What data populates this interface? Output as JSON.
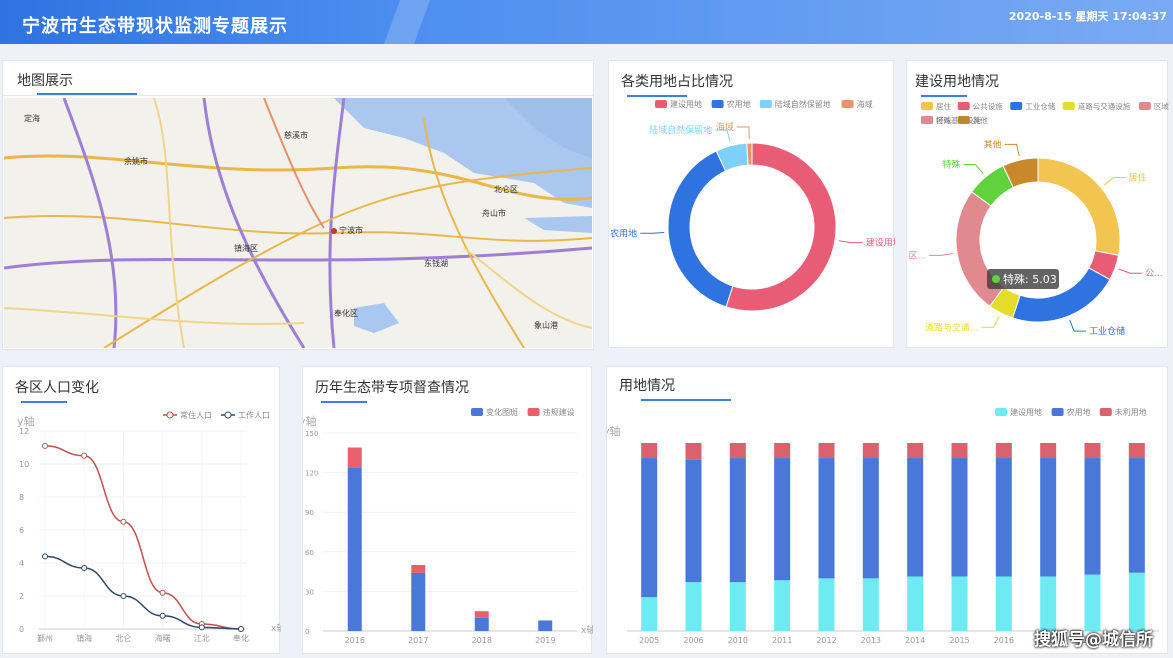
{
  "header": {
    "title": "宁波市生态带现状监测专题展示",
    "datetime": "2020-8-15 星期天 17:04:37"
  },
  "map_panel": {
    "title": "地图展示",
    "labels": [
      "定海",
      "宁波市",
      "舟山市",
      "北仑区",
      "奉化区",
      "余姚市",
      "慈溪市",
      "象山港",
      "东钱湖",
      "镇海区"
    ]
  },
  "landuse_share": {
    "title": "各类用地占比情况"
  },
  "construction_land": {
    "title": "建设用地情况",
    "tooltip": "特殊: 5.03"
  },
  "population": {
    "title": "各区人口变化"
  },
  "supervision": {
    "title": "历年生态带专项督查情况"
  },
  "land_status": {
    "title": "用地情况"
  },
  "footer": {
    "text": "搜狐号@城信所"
  },
  "chart_data": [
    {
      "type": "pie",
      "title": "各类用地占比情况",
      "legend": [
        "建设用地",
        "农用地",
        "陆域自然保留地",
        "海域"
      ],
      "colors": [
        "#e85d75",
        "#2f73e0",
        "#7dd0f7",
        "#e8956d"
      ],
      "values": [
        55,
        38,
        6,
        1
      ],
      "labels": [
        "建设用地",
        "农用地",
        "陆域自然保留地",
        "海域"
      ]
    },
    {
      "type": "pie",
      "title": "建设用地情况",
      "legend": [
        "居住",
        "公共设施",
        "工业仓储",
        "道路与交通设施",
        "区域基础设施",
        "特殊",
        "其他"
      ],
      "colors": [
        "#f2c550",
        "#e85d75",
        "#2f73e0",
        "#e6dd2a",
        "#e08a8f",
        "#5fd23c",
        "#c9882a"
      ],
      "values": [
        28,
        5,
        22,
        5,
        25,
        8,
        7
      ],
      "labels": [
        "居住",
        "公...",
        "工业仓储",
        "道路与交通...",
        "区...",
        "特殊",
        "其他"
      ],
      "tooltip": "特殊: 5.03"
    },
    {
      "type": "line",
      "title": "各区人口变化",
      "ylabel": "y轴",
      "xlabel": "x轴",
      "ylim": [
        0,
        12
      ],
      "yticks": [
        "0",
        "2",
        "4",
        "6",
        "8",
        "10",
        "12"
      ],
      "categories": [
        "鄞州",
        "镇海",
        "北仑",
        "海曙",
        "江北",
        "奉化"
      ],
      "series": [
        {
          "name": "常住人口",
          "color": "#c0504d",
          "values": [
            11.1,
            10.5,
            6.5,
            2.2,
            0.3,
            0
          ]
        },
        {
          "name": "工作人口",
          "color": "#2e4a66",
          "values": [
            4.4,
            3.7,
            2.0,
            0.8,
            0.1,
            0
          ]
        }
      ]
    },
    {
      "type": "bar",
      "title": "历年生态带专项督查情况",
      "ylabel": "y轴",
      "xlabel": "x轴",
      "ylim": [
        0,
        150
      ],
      "yticks": [
        "0",
        "30",
        "60",
        "90",
        "120",
        "150"
      ],
      "categories": [
        "2016",
        "2017",
        "2018",
        "2019"
      ],
      "series": [
        {
          "name": "变化图斑",
          "color": "#4a78d8",
          "values": [
            124,
            44,
            10,
            8
          ]
        },
        {
          "name": "违规建设",
          "color": "#e8606e",
          "values": [
            15,
            6,
            5,
            0
          ]
        }
      ]
    },
    {
      "type": "bar",
      "title": "用地情况",
      "ylabel": "y轴",
      "ylim": [
        0,
        100
      ],
      "categories": [
        "2005",
        "2006",
        "2010",
        "2011",
        "2012",
        "2013",
        "2014",
        "2015",
        "2016",
        "2017",
        "2018",
        "2019"
      ],
      "series": [
        {
          "name": "建设用地",
          "color": "#6eeaf2",
          "values": [
            18,
            26,
            26,
            27,
            28,
            28,
            29,
            29,
            29,
            29,
            30,
            31
          ]
        },
        {
          "name": "农用地",
          "color": "#4a78d8",
          "values": [
            74,
            65,
            66,
            65,
            64,
            64,
            63,
            63,
            63,
            63,
            62,
            61
          ]
        },
        {
          "name": "未利用地",
          "color": "#d9626e",
          "values": [
            8,
            9,
            8,
            8,
            8,
            8,
            8,
            8,
            8,
            8,
            8,
            8
          ]
        }
      ]
    }
  ]
}
